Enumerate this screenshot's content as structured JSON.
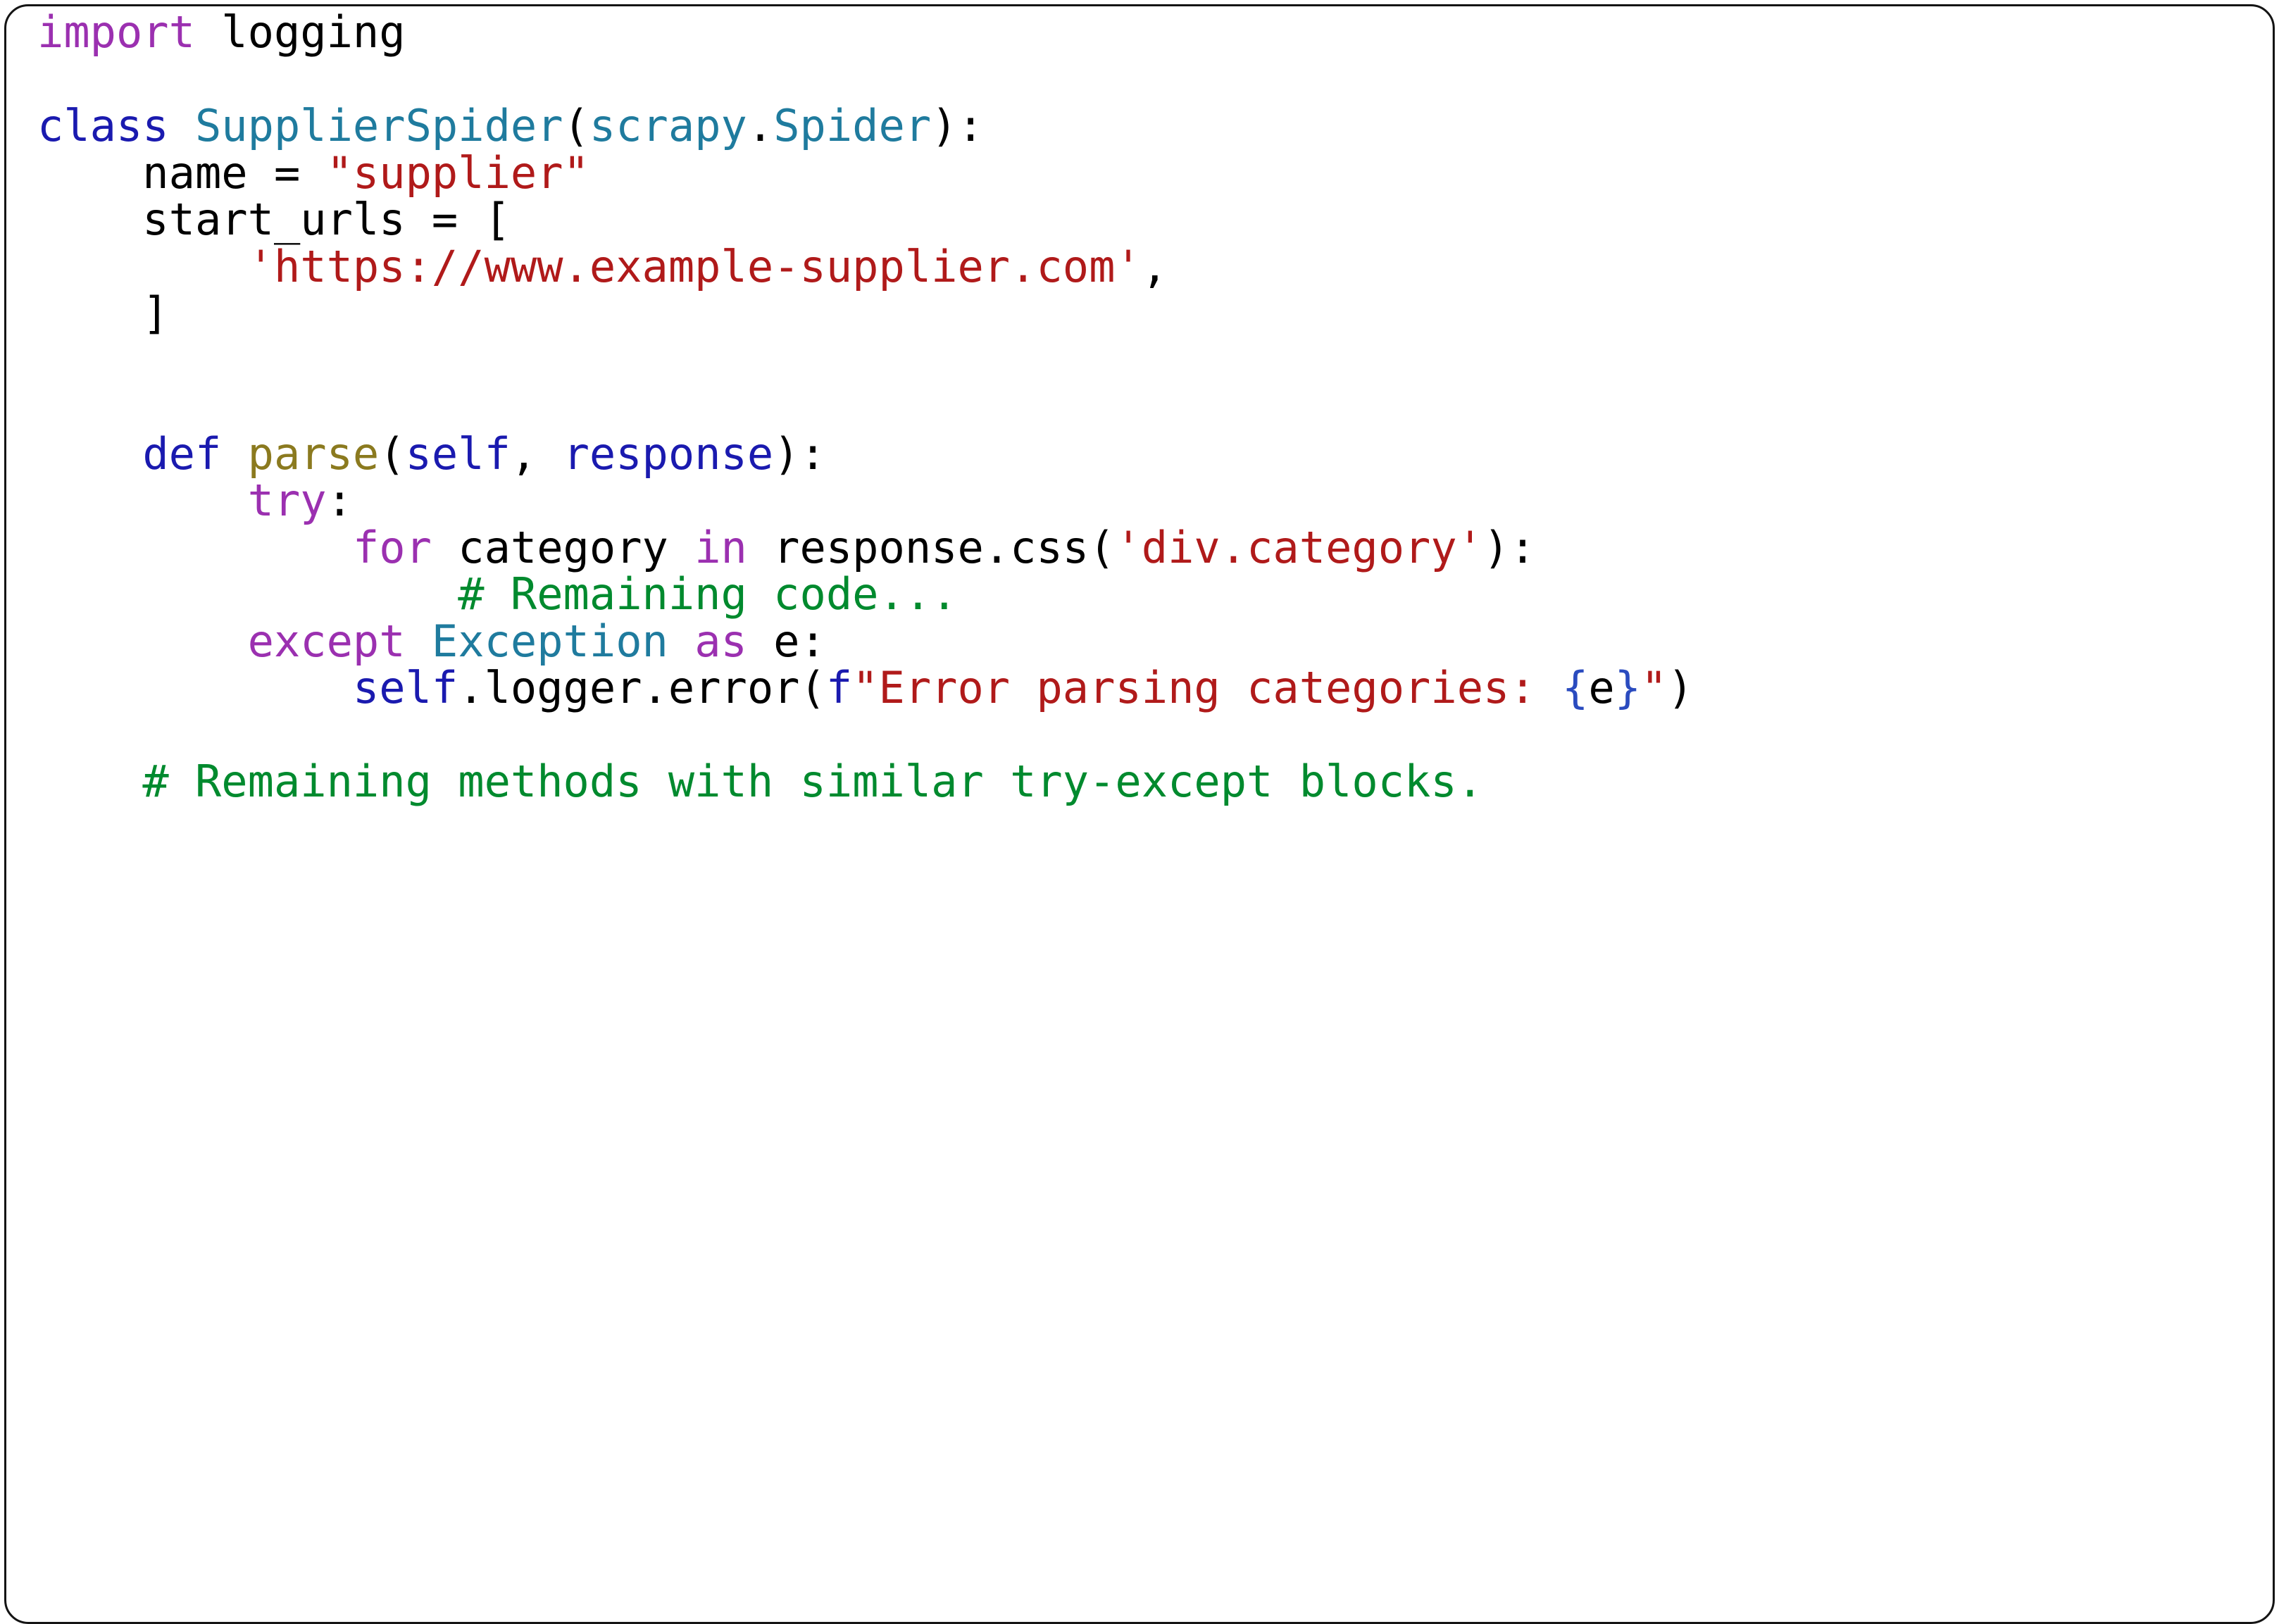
{
  "card": {
    "background_color": "#ffffff",
    "border_color": "#141414",
    "corner_radius_px": 34
  },
  "palette": {
    "plain": "#000000",
    "keyword": "#9B30B0",
    "declaration_keyword": "#1A1AAF",
    "class_name": "#1F7B9E",
    "string": "#B01A1A",
    "comment": "#008A2E",
    "function_name": "#8B7A1F",
    "self_param": "#1A1AAF",
    "fstring_brace": "#2A4BBF"
  },
  "code": {
    "language": "python",
    "plain_text": "import logging\n\nclass SupplierSpider(scrapy.Spider):\n    name = \"supplier\"\n    start_urls = [\n        'https://www.example-supplier.com',\n    ]\n\n\n    def parse(self, response):\n        try:\n            for category in response.css('div.category'):\n                # Remaining code...\n        except Exception as e:\n            self.logger.error(f\"Error parsing categories: {e}\")\n\n    # Remaining methods with similar try-except blocks.",
    "lines": [
      {
        "n": 1,
        "tokens": [
          {
            "t": "import",
            "c": "kw"
          },
          {
            "t": " logging",
            "c": "plain"
          }
        ]
      },
      {
        "n": 2,
        "tokens": []
      },
      {
        "n": 3,
        "tokens": [
          {
            "t": "class",
            "c": "kw2"
          },
          {
            "t": " ",
            "c": "plain"
          },
          {
            "t": "SupplierSpider",
            "c": "cls"
          },
          {
            "t": "(",
            "c": "plain"
          },
          {
            "t": "scrapy",
            "c": "cls"
          },
          {
            "t": ".",
            "c": "plain"
          },
          {
            "t": "Spider",
            "c": "cls"
          },
          {
            "t": "):",
            "c": "plain"
          }
        ]
      },
      {
        "n": 4,
        "tokens": [
          {
            "t": "    name = ",
            "c": "plain"
          },
          {
            "t": "\"supplier\"",
            "c": "str"
          }
        ]
      },
      {
        "n": 5,
        "tokens": [
          {
            "t": "    start_urls = [",
            "c": "plain"
          }
        ]
      },
      {
        "n": 6,
        "tokens": [
          {
            "t": "        ",
            "c": "plain"
          },
          {
            "t": "'https://www.example-supplier.com'",
            "c": "str"
          },
          {
            "t": ",",
            "c": "plain"
          }
        ]
      },
      {
        "n": 7,
        "tokens": [
          {
            "t": "    ]",
            "c": "plain"
          }
        ]
      },
      {
        "n": 8,
        "tokens": []
      },
      {
        "n": 9,
        "tokens": []
      },
      {
        "n": 10,
        "tokens": [
          {
            "t": "    ",
            "c": "plain"
          },
          {
            "t": "def",
            "c": "kw2"
          },
          {
            "t": " ",
            "c": "plain"
          },
          {
            "t": "parse",
            "c": "fn"
          },
          {
            "t": "(",
            "c": "plain"
          },
          {
            "t": "self",
            "c": "self"
          },
          {
            "t": ", ",
            "c": "plain"
          },
          {
            "t": "response",
            "c": "self"
          },
          {
            "t": "):",
            "c": "plain"
          }
        ]
      },
      {
        "n": 11,
        "tokens": [
          {
            "t": "        ",
            "c": "plain"
          },
          {
            "t": "try",
            "c": "kw"
          },
          {
            "t": ":",
            "c": "plain"
          }
        ]
      },
      {
        "n": 12,
        "tokens": [
          {
            "t": "            ",
            "c": "plain"
          },
          {
            "t": "for",
            "c": "kw"
          },
          {
            "t": " category ",
            "c": "plain"
          },
          {
            "t": "in",
            "c": "kw"
          },
          {
            "t": " response.css(",
            "c": "plain"
          },
          {
            "t": "'div.category'",
            "c": "str"
          },
          {
            "t": "):",
            "c": "plain"
          }
        ]
      },
      {
        "n": 13,
        "tokens": [
          {
            "t": "                ",
            "c": "plain"
          },
          {
            "t": "# Remaining code...",
            "c": "com"
          }
        ]
      },
      {
        "n": 14,
        "tokens": [
          {
            "t": "        ",
            "c": "plain"
          },
          {
            "t": "except",
            "c": "kw"
          },
          {
            "t": " ",
            "c": "plain"
          },
          {
            "t": "Exception",
            "c": "cls"
          },
          {
            "t": " ",
            "c": "plain"
          },
          {
            "t": "as",
            "c": "kw"
          },
          {
            "t": " e:",
            "c": "plain"
          }
        ]
      },
      {
        "n": 15,
        "tokens": [
          {
            "t": "            ",
            "c": "plain"
          },
          {
            "t": "self",
            "c": "self"
          },
          {
            "t": ".logger.error(",
            "c": "plain"
          },
          {
            "t": "f",
            "c": "self"
          },
          {
            "t": "\"Error parsing categories: ",
            "c": "str"
          },
          {
            "t": "{",
            "c": "brace"
          },
          {
            "t": "e",
            "c": "plain"
          },
          {
            "t": "}",
            "c": "brace"
          },
          {
            "t": "\"",
            "c": "str"
          },
          {
            "t": ")",
            "c": "plain"
          }
        ]
      },
      {
        "n": 16,
        "tokens": []
      },
      {
        "n": 17,
        "tokens": [
          {
            "t": "    ",
            "c": "plain"
          },
          {
            "t": "# Remaining methods with similar try-except blocks.",
            "c": "com"
          }
        ]
      }
    ]
  }
}
